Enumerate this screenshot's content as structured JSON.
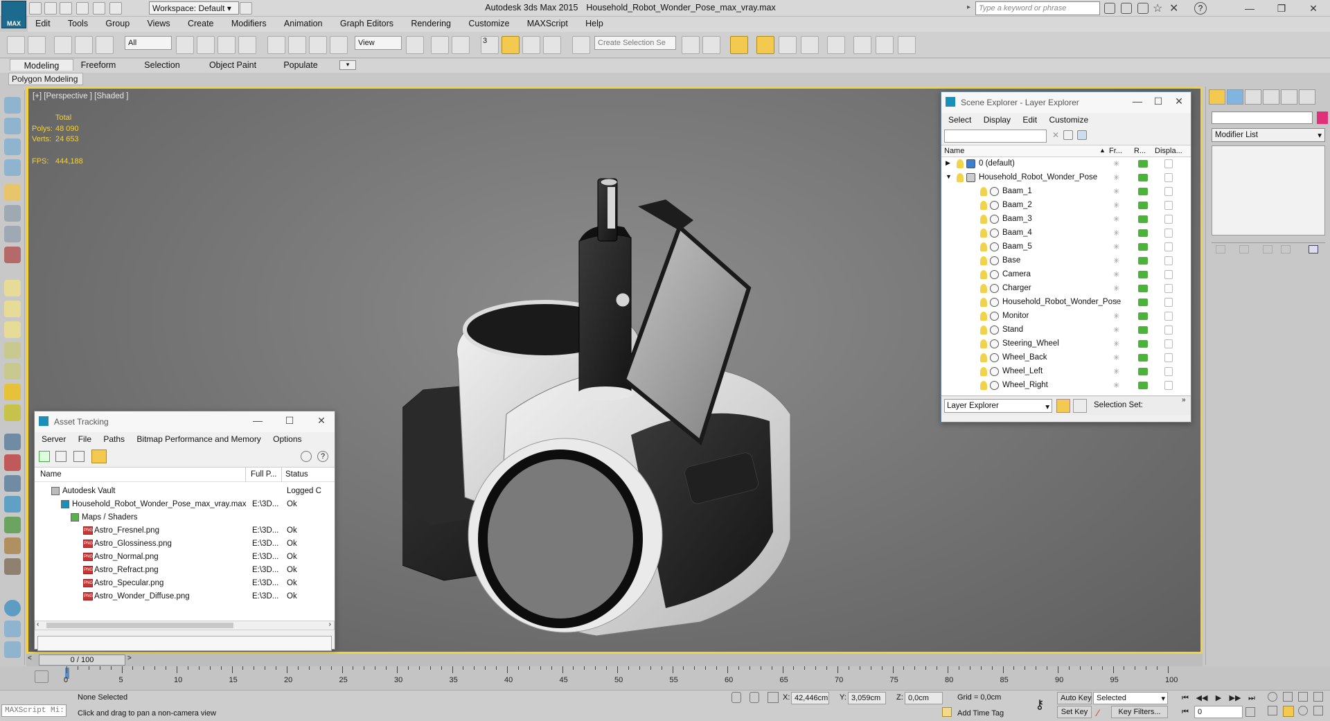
{
  "app": {
    "title": "Autodesk 3ds Max  2015",
    "filename": "Household_Robot_Wonder_Pose_max_vray.max",
    "logo_text": "MAX",
    "workspace": "Workspace: Default",
    "search_placeholder": "Type a keyword or phrase"
  },
  "menu": [
    "Edit",
    "Tools",
    "Group",
    "Views",
    "Create",
    "Modifiers",
    "Animation",
    "Graph Editors",
    "Rendering",
    "Customize",
    "MAXScript",
    "Help"
  ],
  "toolbar": {
    "filter": "All",
    "ref_coord": "View",
    "selection_set_placeholder": "Create Selection Se",
    "snap_label": "3"
  },
  "ribbon": {
    "tabs": [
      "Modeling",
      "Freeform",
      "Selection",
      "Object Paint",
      "Populate"
    ],
    "active_tab": "Modeling",
    "sub": "Polygon Modeling"
  },
  "viewport": {
    "label": "[+] [Perspective ] [Shaded ]",
    "stats": {
      "total_label": "Total",
      "polys_label": "Polys:",
      "polys": "48 090",
      "verts_label": "Verts:",
      "verts": "24 653",
      "fps_label": "FPS:",
      "fps": "444,188"
    },
    "border_color": "#f3d23b"
  },
  "command_panel": {
    "modifier_list": "Modifier List",
    "color_swatch": "#e0307a"
  },
  "scene_explorer": {
    "title": "Scene Explorer - Layer Explorer",
    "menu": [
      "Select",
      "Display",
      "Edit",
      "Customize"
    ],
    "columns": [
      "Name",
      "Fr...",
      "R...",
      "Displa..."
    ],
    "rows": [
      {
        "name": "0 (default)",
        "level": 0
      },
      {
        "name": "Household_Robot_Wonder_Pose",
        "level": 0
      },
      {
        "name": "Baam_1",
        "level": 1
      },
      {
        "name": "Baam_2",
        "level": 1
      },
      {
        "name": "Baam_3",
        "level": 1
      },
      {
        "name": "Baam_4",
        "level": 1
      },
      {
        "name": "Baam_5",
        "level": 1
      },
      {
        "name": "Base",
        "level": 1
      },
      {
        "name": "Camera",
        "level": 1
      },
      {
        "name": "Charger",
        "level": 1
      },
      {
        "name": "Household_Robot_Wonder_Pose",
        "level": 1
      },
      {
        "name": "Monitor",
        "level": 1
      },
      {
        "name": "Stand",
        "level": 1
      },
      {
        "name": "Steering_Wheel",
        "level": 1
      },
      {
        "name": "Wheel_Back",
        "level": 1
      },
      {
        "name": "Wheel_Left",
        "level": 1
      },
      {
        "name": "Wheel_Right",
        "level": 1
      }
    ],
    "explorer_dropdown": "Layer Explorer",
    "selection_set_label": "Selection Set:"
  },
  "asset_tracking": {
    "title": "Asset Tracking",
    "menu": [
      "Server",
      "File",
      "Paths",
      "Bitmap Performance and Memory",
      "Options"
    ],
    "columns": [
      "Name",
      "Full P...",
      "Status"
    ],
    "rows": [
      {
        "name": "Autodesk Vault",
        "path": "",
        "status": "Logged C",
        "level": 0
      },
      {
        "name": "Household_Robot_Wonder_Pose_max_vray.max",
        "path": "E:\\3D...",
        "status": "Ok",
        "level": 1
      },
      {
        "name": "Maps / Shaders",
        "path": "",
        "status": "",
        "level": 2
      },
      {
        "name": "Astro_Fresnel.png",
        "path": "E:\\3D...",
        "status": "Ok",
        "level": 3
      },
      {
        "name": "Astro_Glossiness.png",
        "path": "E:\\3D...",
        "status": "Ok",
        "level": 3
      },
      {
        "name": "Astro_Normal.png",
        "path": "E:\\3D...",
        "status": "Ok",
        "level": 3
      },
      {
        "name": "Astro_Refract.png",
        "path": "E:\\3D...",
        "status": "Ok",
        "level": 3
      },
      {
        "name": "Astro_Specular.png",
        "path": "E:\\3D...",
        "status": "Ok",
        "level": 3
      },
      {
        "name": "Astro_Wonder_Diffuse.png",
        "path": "E:\\3D...",
        "status": "Ok",
        "level": 3
      }
    ],
    "png_icon": "PNG"
  },
  "timeline": {
    "frame": "0 / 100",
    "ticks": [
      "0",
      "5",
      "10",
      "15",
      "20",
      "25",
      "30",
      "35",
      "40",
      "45",
      "50",
      "55",
      "60",
      "65",
      "70",
      "75",
      "80",
      "85",
      "90",
      "95",
      "100"
    ]
  },
  "status": {
    "maxscript": "MAXScript Mi:",
    "selection": "None Selected",
    "prompt": "Click and drag to pan a non-camera view",
    "x_label": "X:",
    "x": "42,446cm",
    "y_label": "Y:",
    "y": "3,059cm",
    "z_label": "Z:",
    "z": "0,0cm",
    "grid": "Grid = 0,0cm",
    "add_time_tag": "Add Time Tag",
    "auto_key": "Auto Key",
    "set_key": "Set Key",
    "key_mode": "Selected",
    "key_filters": "Key Filters...",
    "current_frame": "0"
  }
}
